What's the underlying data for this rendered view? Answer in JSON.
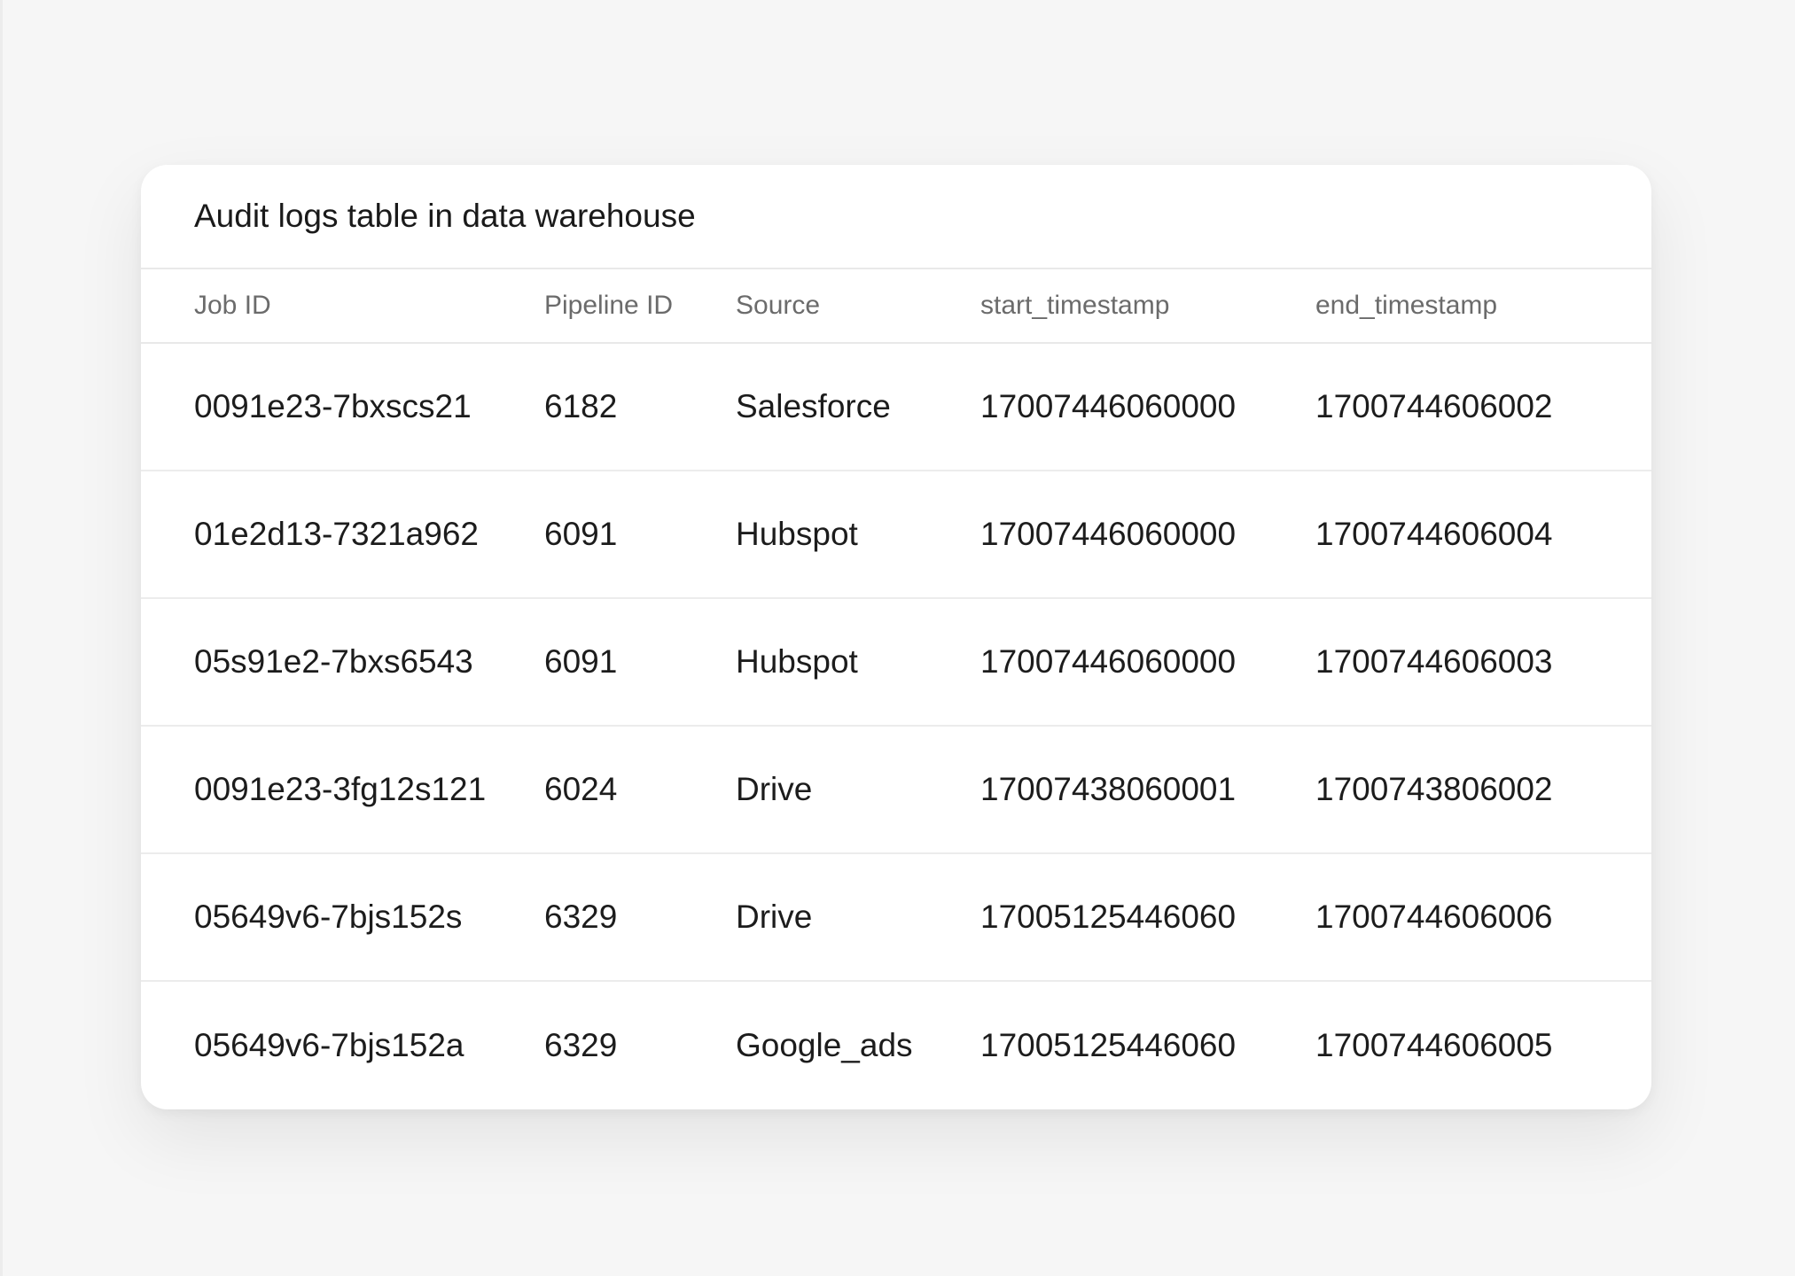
{
  "card": {
    "title": "Audit logs table in data warehouse"
  },
  "table": {
    "columns": [
      "Job ID",
      "Pipeline ID",
      "Source",
      "start_timestamp",
      "end_timestamp"
    ],
    "rows": [
      [
        "0091e23-7bxscs21",
        "6182",
        "Salesforce",
        "17007446060000",
        "1700744606002"
      ],
      [
        "01e2d13-7321a962",
        "6091",
        "Hubspot",
        "17007446060000",
        "1700744606004"
      ],
      [
        "05s91e2-7bxs6543",
        "6091",
        "Hubspot",
        "17007446060000",
        "1700744606003"
      ],
      [
        "0091e23-3fg12s121",
        "6024",
        "Drive",
        "17007438060001",
        "1700743806002"
      ],
      [
        "05649v6-7bjs152s",
        "6329",
        "Drive",
        "17005125446060",
        "1700744606006"
      ],
      [
        "05649v6-7bjs152a",
        "6329",
        "Google_ads",
        "17005125446060",
        "1700744606005"
      ]
    ]
  },
  "colors": {
    "background": "#f6f6f6",
    "card": "#ffffff",
    "text": "#1c1c1c",
    "header_text": "#6b6b6b",
    "divider": "#e9e9e9"
  }
}
